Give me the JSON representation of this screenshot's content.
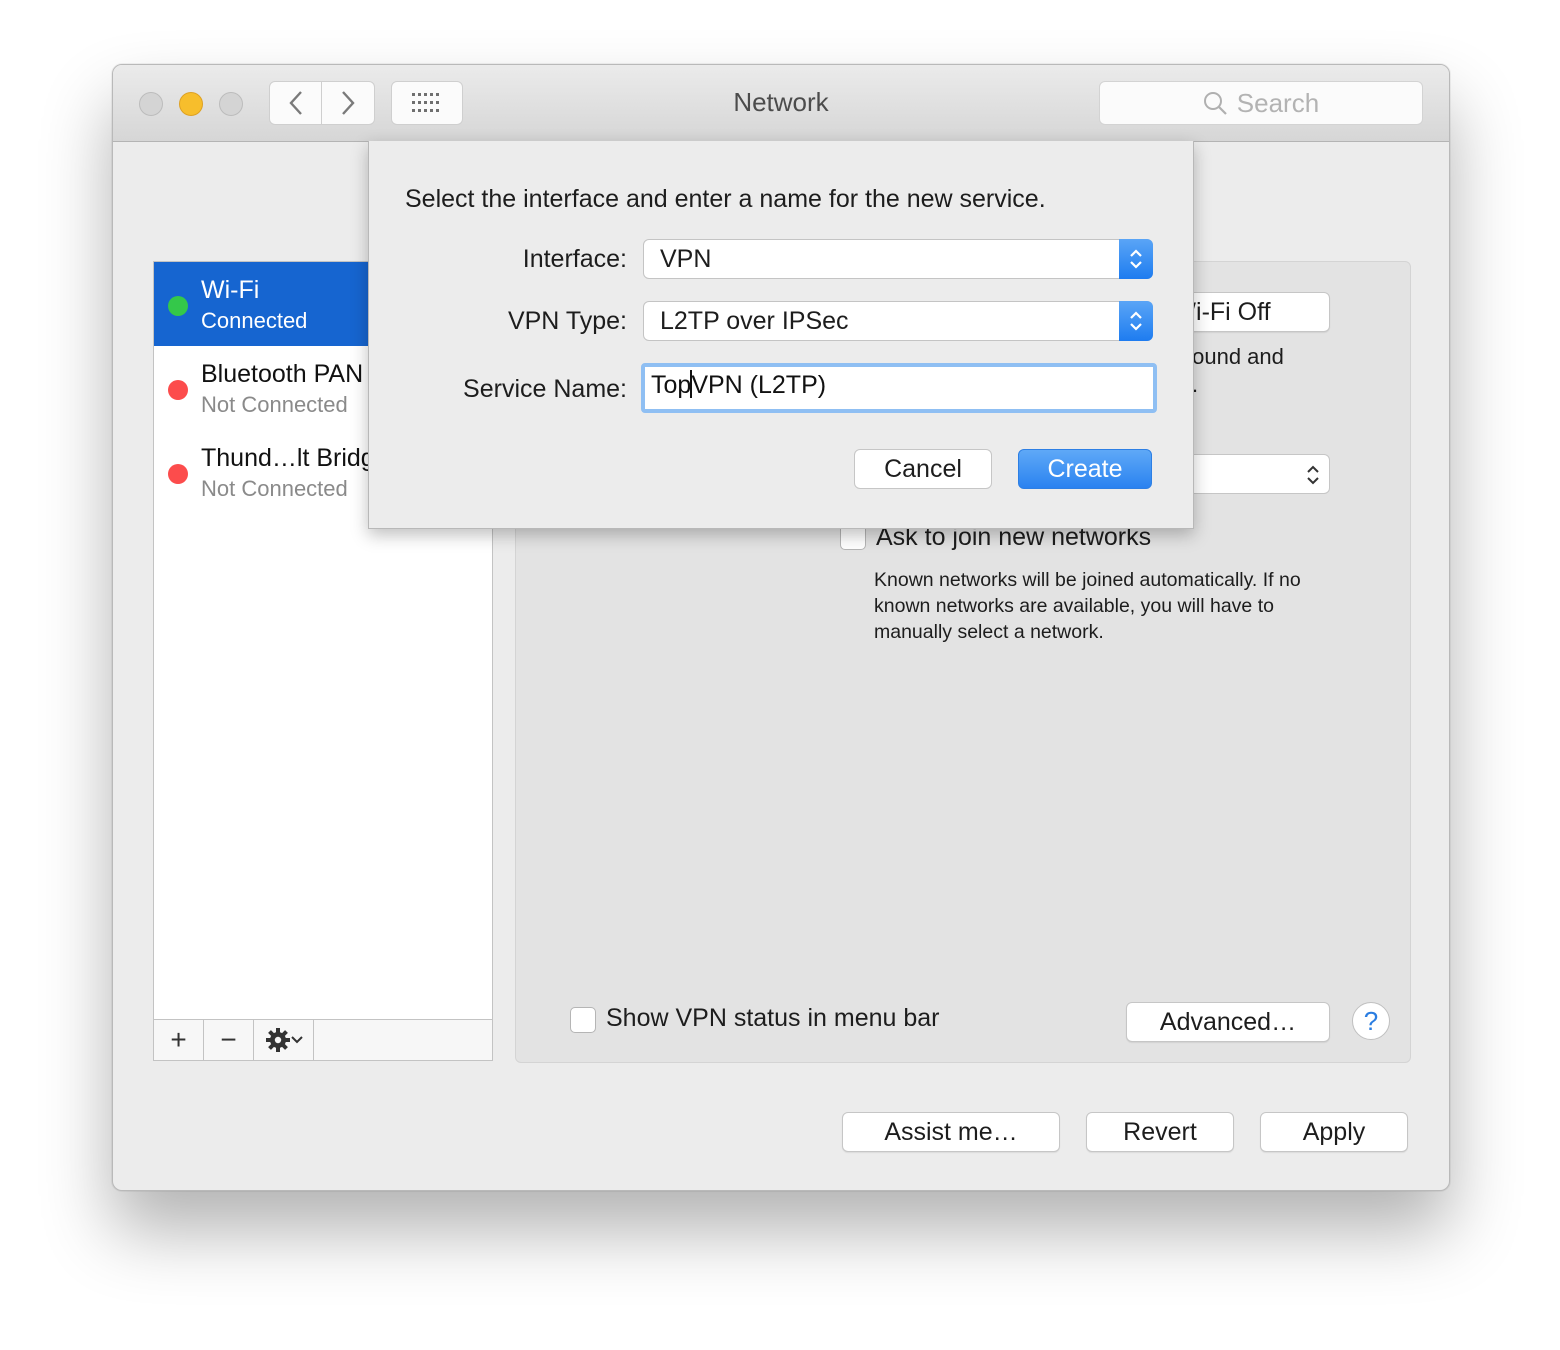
{
  "window": {
    "title": "Network",
    "search_placeholder": "Search"
  },
  "sidebar": {
    "services": [
      {
        "name": "Wi-Fi",
        "status": "Connected",
        "status_color": "#34c84a",
        "selected": true
      },
      {
        "name": "Bluetooth PAN",
        "status": "Not Connected",
        "status_color": "#fc4c4c",
        "selected": false
      },
      {
        "name": "Thund…lt Bridge",
        "status": "Not Connected",
        "status_color": "#fc4c4c",
        "selected": false
      }
    ],
    "add_label": "+",
    "remove_label": "−"
  },
  "panel": {
    "wifi_off_label": "Turn Wi-Fi Off",
    "partial_text_1": "found and",
    "partial_text_2": ".",
    "ask_join_label": "Ask to join new networks",
    "ask_join_desc": "Known networks will be joined automatically. If no known networks are available, you will have to manually select a network.",
    "show_vpn_label": "Show VPN status in menu bar",
    "advanced_label": "Advanced…",
    "help_label": "?"
  },
  "footer": {
    "assist_label": "Assist me…",
    "revert_label": "Revert",
    "apply_label": "Apply"
  },
  "sheet": {
    "prompt": "Select the interface and enter a name for the new service.",
    "interface_label": "Interface:",
    "interface_value": "VPN",
    "vpn_type_label": "VPN Type:",
    "vpn_type_value": "L2TP over IPSec",
    "service_name_label": "Service Name:",
    "service_name_before_caret": "Top",
    "service_name_after_caret": "VPN (L2TP)",
    "cancel_label": "Cancel",
    "create_label": "Create"
  },
  "colors": {
    "accent": "#1665d0",
    "create_button": "#2a82f0",
    "minimize_light": "#f7be2c"
  }
}
